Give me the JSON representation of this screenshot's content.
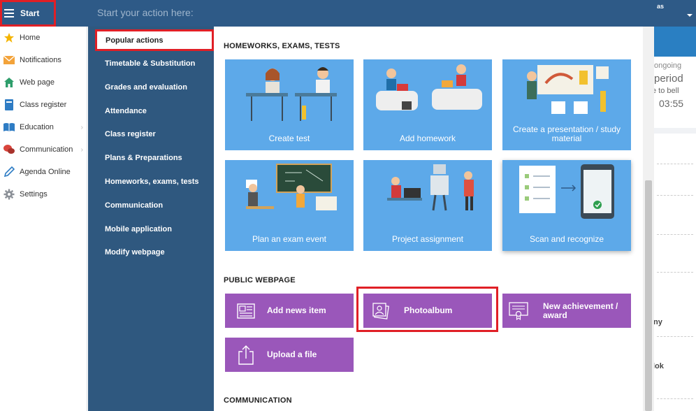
{
  "start_button": {
    "label": "Start"
  },
  "search": {
    "placeholder": "Start your action here:"
  },
  "top_right": {
    "abbr": "as"
  },
  "app_sidebar": {
    "items": [
      {
        "label": "Home",
        "icon": "star-icon"
      },
      {
        "label": "Notifications",
        "icon": "envelope-icon"
      },
      {
        "label": "Web page",
        "icon": "house-icon"
      },
      {
        "label": "Class register",
        "icon": "notebook-icon"
      },
      {
        "label": "Education",
        "icon": "book-icon"
      },
      {
        "label": "Communication",
        "icon": "chat-icon"
      },
      {
        "label": "Agenda Online",
        "icon": "pen-icon"
      },
      {
        "label": "Settings",
        "icon": "gear-icon"
      }
    ]
  },
  "background_right": {
    "lines": [
      "ongoing",
      "period",
      "e to bell",
      "03:55",
      "iny",
      "lok"
    ]
  },
  "mega_nav": {
    "items": [
      "Popular actions",
      "Timetable & Substitution",
      "Grades and evaluation",
      "Attendance",
      "Class register",
      "Plans & Preparations",
      "Homeworks, exams, tests",
      "Communication",
      "Mobile application",
      "Modify webpage"
    ]
  },
  "sections": {
    "homeworks": {
      "title": "HOMEWORKS, EXAMS, TESTS",
      "tiles": [
        "Create test",
        "Add homework",
        "Create a presentation / study material",
        "Plan an exam event",
        "Project assignment",
        "Scan and recognize"
      ]
    },
    "public_webpage": {
      "title": "PUBLIC WEBPAGE",
      "tiles": [
        "Add news item",
        "Photoalbum",
        "New achievement / award",
        "Upload a file"
      ]
    },
    "communication": {
      "title": "COMMUNICATION"
    }
  },
  "colors": {
    "topbar": "#2e5a87",
    "mega_nav": "#2f587f",
    "tile_blue": "#5da9e9",
    "tile_purple": "#9a57ba",
    "highlight": "#e01f26"
  }
}
